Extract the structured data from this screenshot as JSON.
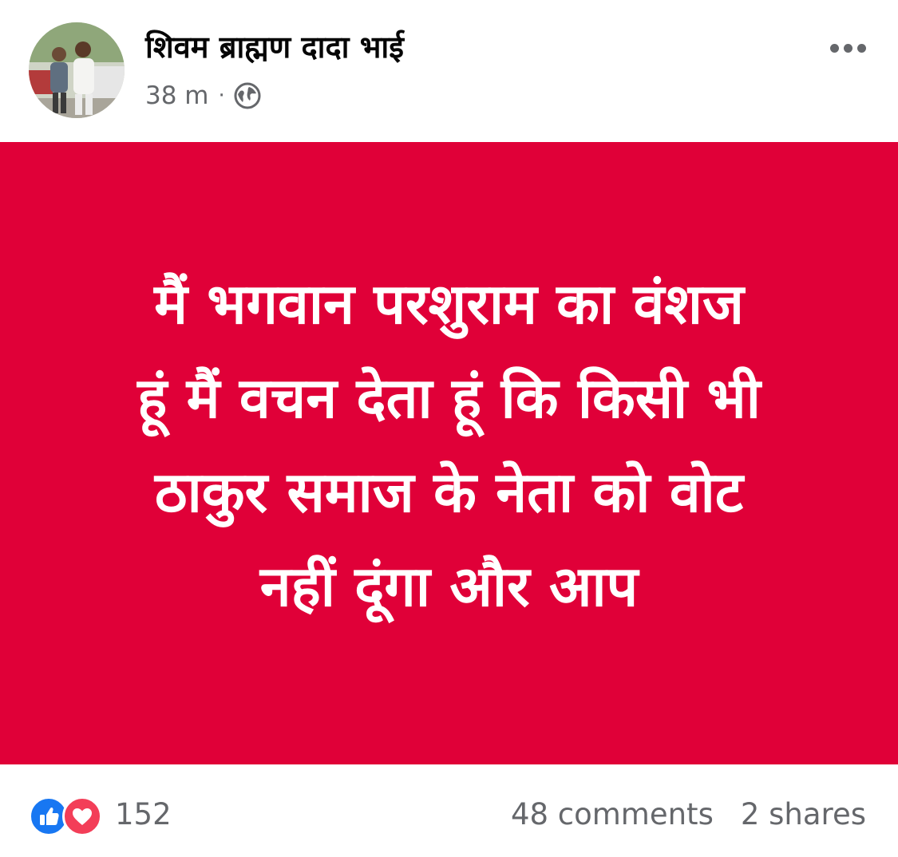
{
  "post": {
    "author": "शिवम ब्राह्मण दादा भाई",
    "time": "38 m",
    "separator": "·",
    "privacy_icon": "globe-icon",
    "more_icon": "more-options-icon",
    "card": {
      "background": "#e00038",
      "text_color": "#ffffff",
      "lines": [
        "मैं भगवान परशुराम का वंशज",
        "हूं मैं वचन देता हूं कि किसी भी",
        "ठाकुर समाज के नेता को वोट",
        "नहीं दूंगा और आप"
      ]
    },
    "footer": {
      "reaction_icons": [
        "like-icon",
        "love-icon"
      ],
      "reaction_count": "152",
      "comments": "48 comments",
      "shares": "2 shares"
    }
  },
  "colors": {
    "like_blue": "#1877f2",
    "love_red": "#f33e58",
    "meta_gray": "#65676b"
  }
}
